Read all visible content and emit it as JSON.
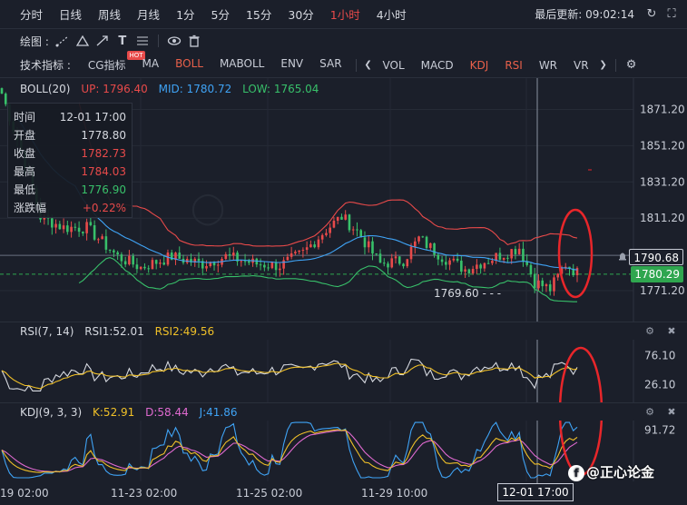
{
  "timeframes": [
    {
      "label": "分时",
      "active": false
    },
    {
      "label": "日线",
      "active": false
    },
    {
      "label": "周线",
      "active": false
    },
    {
      "label": "月线",
      "active": false
    },
    {
      "label": "1分",
      "active": false
    },
    {
      "label": "5分",
      "active": false
    },
    {
      "label": "15分",
      "active": false
    },
    {
      "label": "30分",
      "active": false
    },
    {
      "label": "1小时",
      "active": true
    },
    {
      "label": "4小时",
      "active": false
    }
  ],
  "last_update": "最后更新: 09:02:14",
  "drawing_label": "绘图 :",
  "tech_label": "技术指标 :",
  "indicators_left": [
    {
      "label": "CG指标",
      "active": false,
      "hot": true
    },
    {
      "label": "MA",
      "active": false
    },
    {
      "label": "BOLL",
      "active": true
    },
    {
      "label": "MABOLL",
      "active": false
    },
    {
      "label": "ENV",
      "active": false
    },
    {
      "label": "SAR",
      "active": false
    }
  ],
  "indicators_right": [
    {
      "label": "VOL",
      "active": false
    },
    {
      "label": "MACD",
      "active": false
    },
    {
      "label": "KDJ",
      "active": true
    },
    {
      "label": "RSI",
      "active": true
    },
    {
      "label": "WR",
      "active": false
    },
    {
      "label": "VR",
      "active": false
    }
  ],
  "hot_badge": "HOT",
  "boll_legend": {
    "name": "BOLL(20)",
    "up": "UP: 1796.40",
    "mid": "MID: 1780.72",
    "low": "LOW: 1765.04"
  },
  "rsi_legend": {
    "name": "RSI(7, 14)",
    "rsi1": "RSI1:52.01",
    "rsi2": "RSI2:49.56"
  },
  "kdj_legend": {
    "name": "KDJ(9, 3, 3)",
    "k": "K:52.91",
    "d": "D:58.44",
    "j": "J:41.86"
  },
  "infobox": [
    {
      "key": "时间",
      "value": "12-01 17:00",
      "color": "#d6d9e0"
    },
    {
      "key": "开盘",
      "value": "1778.80",
      "color": "#d6d9e0"
    },
    {
      "key": "收盘",
      "value": "1782.73",
      "color": "#e84a4a"
    },
    {
      "key": "最高",
      "value": "1784.03",
      "color": "#e84a4a"
    },
    {
      "key": "最低",
      "value": "1776.90",
      "color": "#38c06a"
    },
    {
      "key": "涨跌幅",
      "value": "+0.22%",
      "color": "#e84a4a"
    }
  ],
  "price_axis": [
    "1871.20",
    "1851.20",
    "1831.20",
    "1811.20",
    "1771.20"
  ],
  "last_price": "1790.68",
  "current_price": "1780.29",
  "min_marker": "1769.60",
  "rsi_axis": [
    "76.10",
    "26.10"
  ],
  "kdj_axis": [
    "91.72"
  ],
  "time_axis": [
    "19 02:00",
    "11-23 02:00",
    "11-25 02:00",
    "11-29 10:00"
  ],
  "crosshair_time": "12-01 17:00",
  "watermark": "@正心论金",
  "watermark_logo": "f",
  "colors": {
    "up": "#e84a4a",
    "down": "#38c06a",
    "boll_up": "#e84a4a",
    "boll_mid": "#3fa3f5",
    "boll_low": "#38c06a",
    "rsi1": "#d6d9e0",
    "rsi2": "#f0c028",
    "kdj_k": "#f0c028",
    "kdj_d": "#e06ad0",
    "kdj_j": "#3fa3f5",
    "annotation": "#e8262a"
  }
}
